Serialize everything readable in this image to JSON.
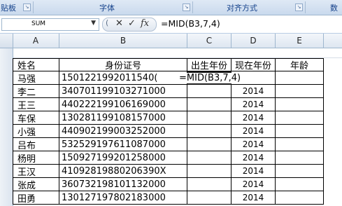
{
  "ribbon": {
    "groups": [
      {
        "label": "贴板"
      },
      {
        "label": "字体"
      },
      {
        "label": "对齐方式"
      },
      {
        "label": "数"
      }
    ]
  },
  "formula_bar": {
    "name_box": "SUM",
    "cancel_glyph": "✕",
    "enter_glyph": "✓",
    "fx_glyph": "fx",
    "content": "=MID(B3,7,4)"
  },
  "columns": [
    "A",
    "B",
    "C",
    "D",
    "E"
  ],
  "table": {
    "headers": [
      "姓名",
      "身份证号",
      "出生年份",
      "现在年份",
      "年龄"
    ],
    "rows": [
      {
        "name": "马强",
        "id": "1501221992011540(",
        "birth": "",
        "year": "",
        "age": ""
      },
      {
        "name": "李二",
        "id": "340701199103271000",
        "birth": "",
        "year": "2014",
        "age": ""
      },
      {
        "name": "王三",
        "id": "440222199106169000",
        "birth": "",
        "year": "2014",
        "age": ""
      },
      {
        "name": "车保",
        "id": "130281199108157000",
        "birth": "",
        "year": "2014",
        "age": ""
      },
      {
        "name": "小强",
        "id": "440902199003252000",
        "birth": "",
        "year": "2014",
        "age": ""
      },
      {
        "name": "吕布",
        "id": "532529197611087000",
        "birth": "",
        "year": "2014",
        "age": ""
      },
      {
        "name": "杨明",
        "id": "150927199201258000",
        "birth": "",
        "year": "2014",
        "age": ""
      },
      {
        "name": "王汉",
        "id": "41092819880206390X",
        "birth": "",
        "year": "2014",
        "age": ""
      },
      {
        "name": "张成",
        "id": "360732198101132000",
        "birth": "",
        "year": "2014",
        "age": ""
      },
      {
        "name": "田勇",
        "id": "130127197802183000",
        "birth": "",
        "year": "2014",
        "age": ""
      }
    ]
  },
  "editing_cell_text": "=MID(B3,7,4)"
}
